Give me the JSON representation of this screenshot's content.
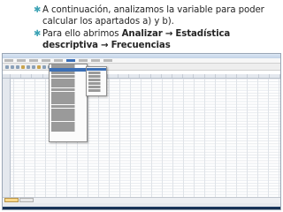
{
  "slide": {
    "bullet_1": "A continuación, analizamos la variable para poder calcular los apartados a) y b).",
    "bullet_2_prefix": "Para ello abrimos ",
    "bullet_2_menu": "Analizar",
    "bullet_2_arrow_1": "→",
    "bullet_2_submenu": "Estadística descriptiva",
    "bullet_2_arrow_2": "→",
    "bullet_2_item": "Frecuencias"
  },
  "colors": {
    "bullet": "#3da3b5",
    "menu_highlight": "#3b6fb6",
    "taskbar": "#1d3c64"
  }
}
